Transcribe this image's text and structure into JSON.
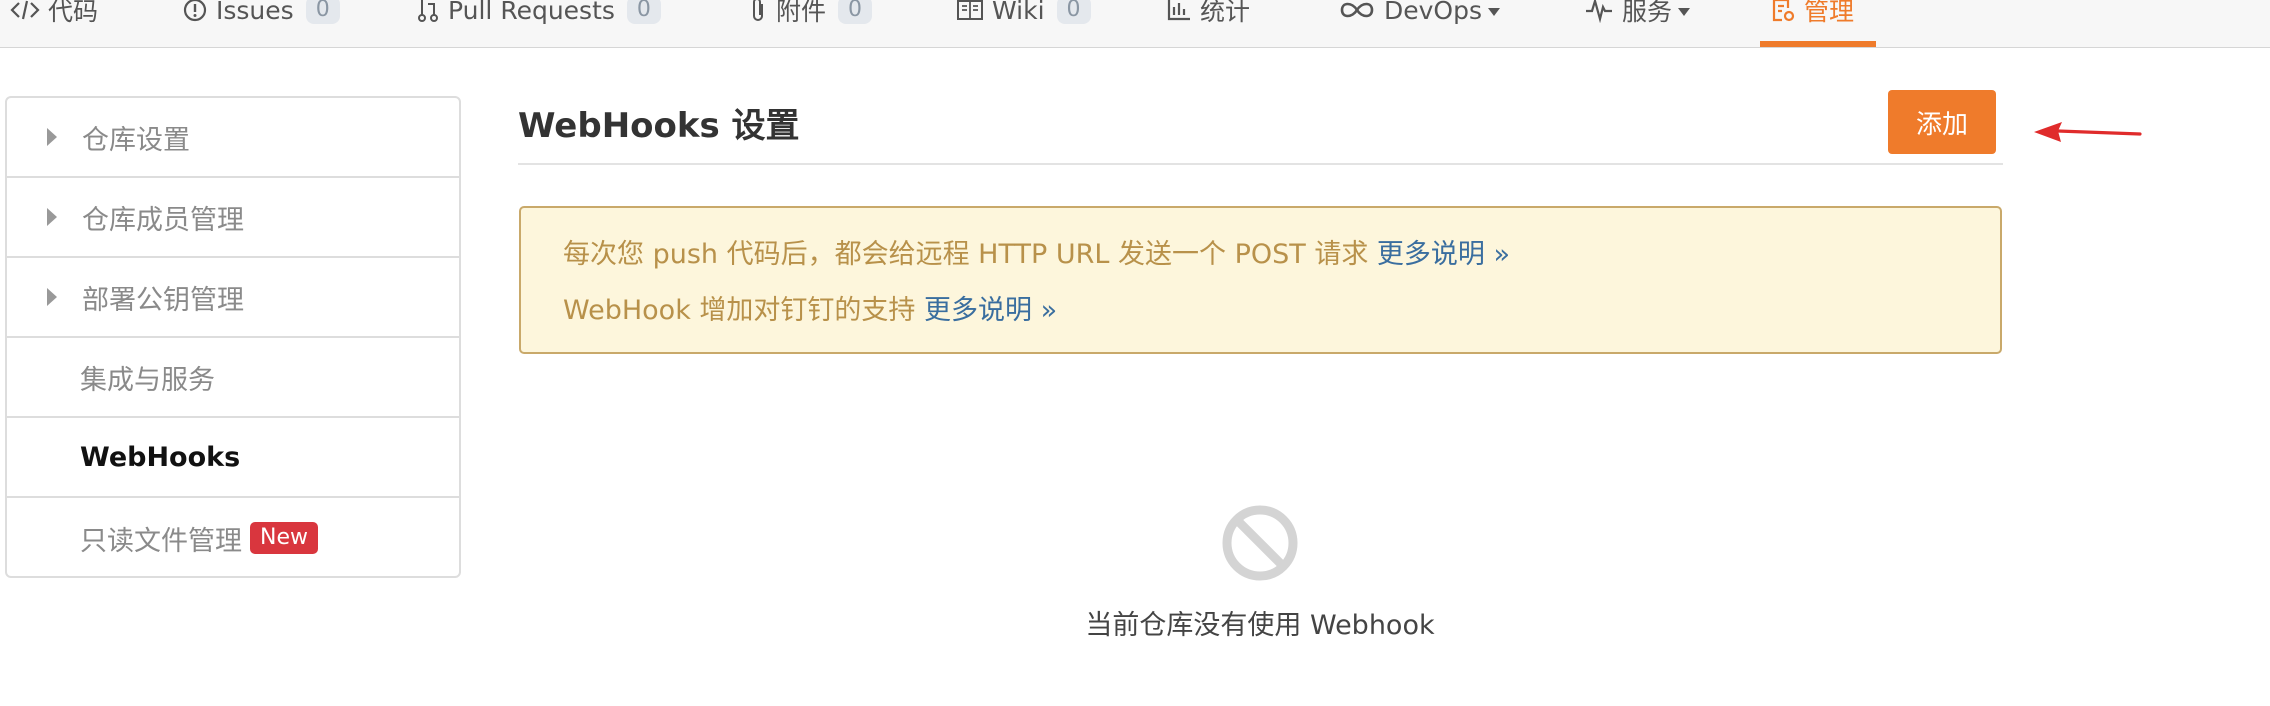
{
  "nav": {
    "items": [
      {
        "label": "代码",
        "icon": "code-icon"
      },
      {
        "label": "Issues",
        "icon": "issue-icon",
        "count": "0"
      },
      {
        "label": "Pull Requests",
        "icon": "pull-request-icon",
        "count": "0"
      },
      {
        "label": "附件",
        "icon": "paperclip-icon",
        "count": "0"
      },
      {
        "label": "Wiki",
        "icon": "book-icon",
        "count": "0"
      },
      {
        "label": "统计",
        "icon": "bar-chart-icon"
      },
      {
        "label": "DevOps",
        "icon": "infinity-icon"
      },
      {
        "label": "服务",
        "icon": "pulse-icon"
      },
      {
        "label": "管理",
        "icon": "settings-doc-icon",
        "active": true
      }
    ],
    "accent_color": "#ef7b2b"
  },
  "sidebar": {
    "items": [
      {
        "label": "仓库设置",
        "expandable": true
      },
      {
        "label": "仓库成员管理",
        "expandable": true
      },
      {
        "label": "部署公钥管理",
        "expandable": true
      },
      {
        "label": "集成与服务",
        "expandable": false
      },
      {
        "label": "WebHooks",
        "expandable": false,
        "active": true
      },
      {
        "label": "只读文件管理",
        "expandable": false,
        "badge": "New"
      }
    ]
  },
  "main": {
    "title": "WebHooks 设置",
    "add_button": "添加",
    "notice": {
      "line1_text": "每次您 push 代码后，都会给远程 HTTP URL 发送一个 POST 请求 ",
      "line1_link": "更多说明 »",
      "line2_text": "WebHook 增加对钉钉的支持 ",
      "line2_link": "更多说明 »"
    },
    "empty_text": "当前仓库没有使用 Webhook"
  },
  "colors": {
    "accent": "#ef7b2b",
    "notice_bg": "#fdf6dc",
    "notice_text": "#b8914a",
    "link": "#3a6e9f",
    "new_badge": "#d9363e",
    "annotation_arrow": "#e02b2b"
  }
}
